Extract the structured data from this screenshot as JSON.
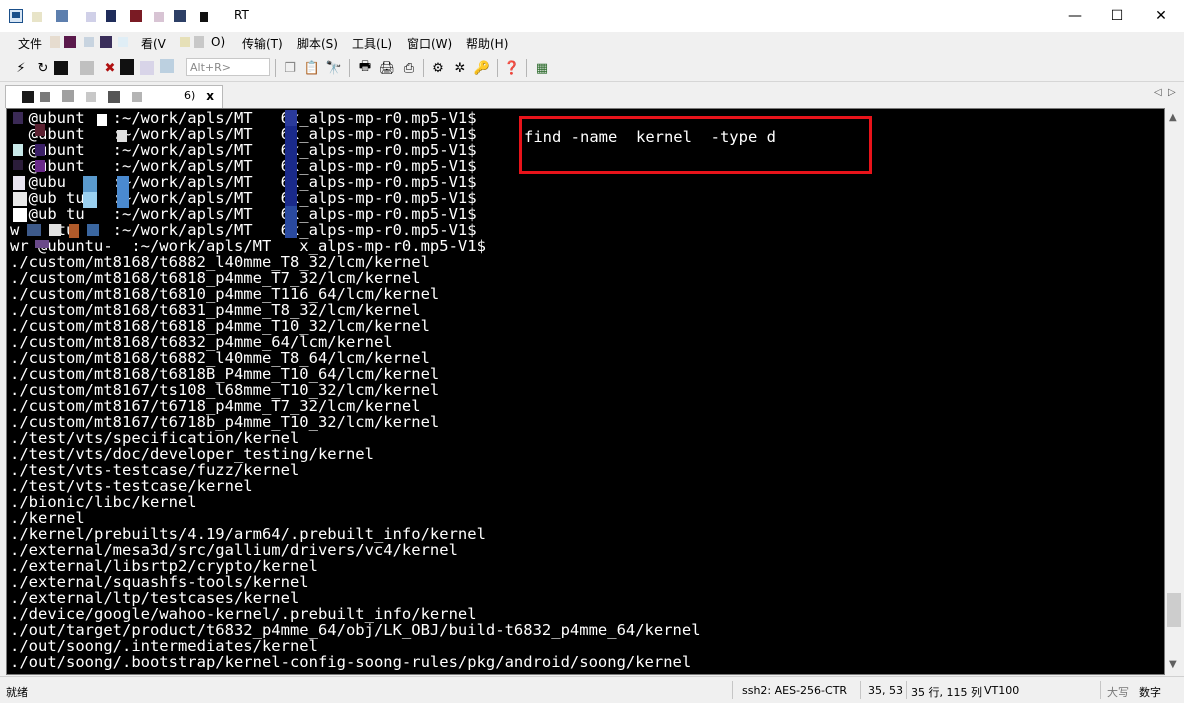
{
  "window": {
    "title": "RT",
    "minimize": "—",
    "maximize": "☐",
    "close": "✕"
  },
  "menu": {
    "items": [
      "文件",
      "看(V",
      "O)",
      "传输(T)",
      "脚本(S)",
      "工具(L)",
      "窗口(W)",
      "帮助(H)"
    ]
  },
  "toolbar": {
    "input_placeholder": "Alt+R>",
    "icons": [
      "connect-icon",
      "reconnect-icon",
      "disconnect-icon",
      "copy-icon",
      "paste-icon",
      "find-icon",
      "print-icon",
      "print-setup-icon",
      "settings-icon",
      "key-icon",
      "help-icon",
      "keymap-icon"
    ]
  },
  "tab": {
    "label": "6)",
    "close": "x"
  },
  "terminal": {
    "lines": [
      "  @ubunt   :~/work/apls/MT   6x_alps-mp-r0.mp5-V1$",
      "  @ubunt   :~/work/apls/MT   6x_alps-mp-r0.mp5-V1$",
      "  @ubunt   :~/work/apls/MT   6x_alps-mp-r0.mp5-V1$",
      "  @ubunt   :~/work/apls/MT   6x_alps-mp-r0.mp5-V1$",
      "  @ubu     :~/work/apls/MT   6x_alps-mp-r0.mp5-V1$",
      "  @ub tu   :~/work/apls/MT   6x_alps-mp-r0.mp5-V1$",
      "  @ub tu   :~/work/apls/MT   6x_alps-mp-r0.mp5-V1$",
      "w    tu    :~/work/apls/MT   6x_alps-mp-r0.mp5-V1$",
      "wr @ubuntu-  :~/work/apls/MT   x_alps-mp-r0.mp5-V1$",
      "./custom/mt8168/t6882_l40mme_T8_32/lcm/kernel",
      "./custom/mt8168/t6818_p4mme_T7_32/lcm/kernel",
      "./custom/mt8168/t6810_p4mme_T116_64/lcm/kernel",
      "./custom/mt8168/t6831_p4mme_T8_32/lcm/kernel",
      "./custom/mt8168/t6818_p4mme_T10_32/lcm/kernel",
      "./custom/mt8168/t6832_p4mme_64/lcm/kernel",
      "./custom/mt8168/t6882_l40mme_T8_64/lcm/kernel",
      "./custom/mt8168/t6818B_P4mme_T10_64/lcm/kernel",
      "./custom/mt8167/ts108_l68mme_T10_32/lcm/kernel",
      "./custom/mt8167/t6718_p4mme_T7_32/lcm/kernel",
      "./custom/mt8167/t6718b_p4mme_T10_32/lcm/kernel",
      "./test/vts/specification/kernel",
      "./test/vts/doc/developer_testing/kernel",
      "./test/vts-testcase/fuzz/kernel",
      "./test/vts-testcase/kernel",
      "./bionic/libc/kernel",
      "./kernel",
      "./kernel/prebuilts/4.19/arm64/.prebuilt_info/kernel",
      "./external/mesa3d/src/gallium/drivers/vc4/kernel",
      "./external/libsrtp2/crypto/kernel",
      "./external/squashfs-tools/kernel",
      "./external/ltp/testcases/kernel",
      "./device/google/wahoo-kernel/.prebuilt_info/kernel",
      "./out/target/product/t6832_p4mme_64/obj/LK_OBJ/build-t6832_p4mme_64/kernel",
      "./out/soong/.intermediates/kernel",
      "./out/soong/.bootstrap/kernel-config-soong-rules/pkg/android/soong/kernel"
    ],
    "command": "find -name  kernel  -type d",
    "highlight_color": "#e8131a"
  },
  "status": {
    "ready": "就绪",
    "cipher": "ssh2: AES-256-CTR",
    "cursor": "35,  53",
    "size": "35 行, 115 列",
    "emulation": "VT100",
    "caps": "大写",
    "num": "数字"
  }
}
